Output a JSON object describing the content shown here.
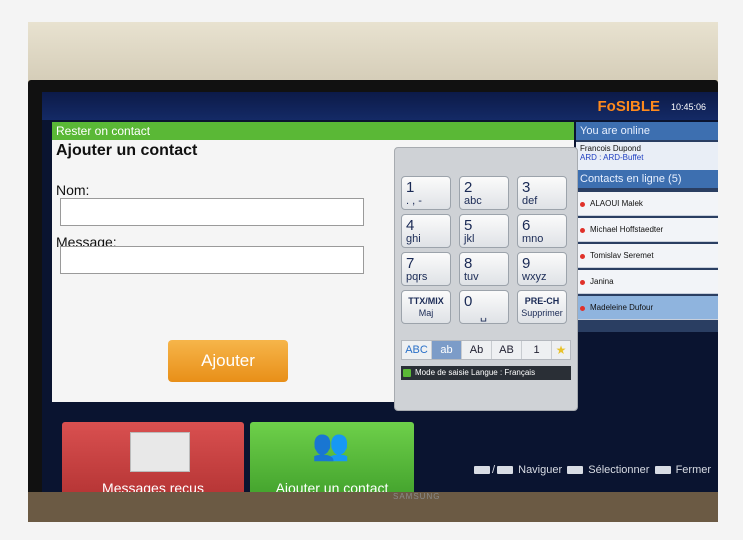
{
  "header": {
    "brand": "FoSIBLE",
    "time": "10:45:06"
  },
  "tv": {
    "brand": "SAMSUNG"
  },
  "section_title": "Rester on contact",
  "form": {
    "title": "Ajouter un contact",
    "name_label": "Nom:",
    "name_value": "",
    "message_label": "Message:",
    "message_value": "",
    "submit_label": "Ajouter"
  },
  "keypad": {
    "keys": [
      {
        "digit": "1",
        "letters": ". , -"
      },
      {
        "digit": "2",
        "letters": "abc"
      },
      {
        "digit": "3",
        "letters": "def"
      },
      {
        "digit": "4",
        "letters": "ghi"
      },
      {
        "digit": "5",
        "letters": "jkl"
      },
      {
        "digit": "6",
        "letters": "mno"
      },
      {
        "digit": "7",
        "letters": "pqrs"
      },
      {
        "digit": "8",
        "letters": "tuv"
      },
      {
        "digit": "9",
        "letters": "wxyz"
      }
    ],
    "ttx_label": "TTX/MIX",
    "ttx_sub": "Maj",
    "zero_digit": "0",
    "zero_letters": "␣",
    "prech_label": "PRE-CH",
    "prech_sub": "Supprimer",
    "modes": [
      "ABC",
      "ab",
      "Ab",
      "AB",
      "1"
    ],
    "active_mode": "ab",
    "footer_mode": "Mode de saisie",
    "footer_lang": "Langue : Français"
  },
  "right_panel": {
    "online_heading": "You are online",
    "user_name": "Francois Dupond",
    "user_sub": "ARD : ARD-Buffet",
    "contacts_heading": "Contacts en ligne (5)",
    "contacts": [
      "ALAOUI Malek",
      "Michael Hoffstaedter",
      "Tomislav Seremet",
      "Janina",
      "Madeleine Dufour"
    ]
  },
  "tiles": {
    "messages_label": "Messages reçus",
    "add_contact_label": "Ajouter un contact"
  },
  "hints": {
    "navigate": "Naviguer",
    "select": "Sélectionner",
    "close": "Fermer"
  },
  "colors": {
    "brand": "#ff8a1c",
    "green_bar": "#5ab836",
    "submit": "#f0a030",
    "messages_tile": "#c83c3c",
    "add_tile": "#52b83a",
    "contact_dot": "#e0312a"
  }
}
